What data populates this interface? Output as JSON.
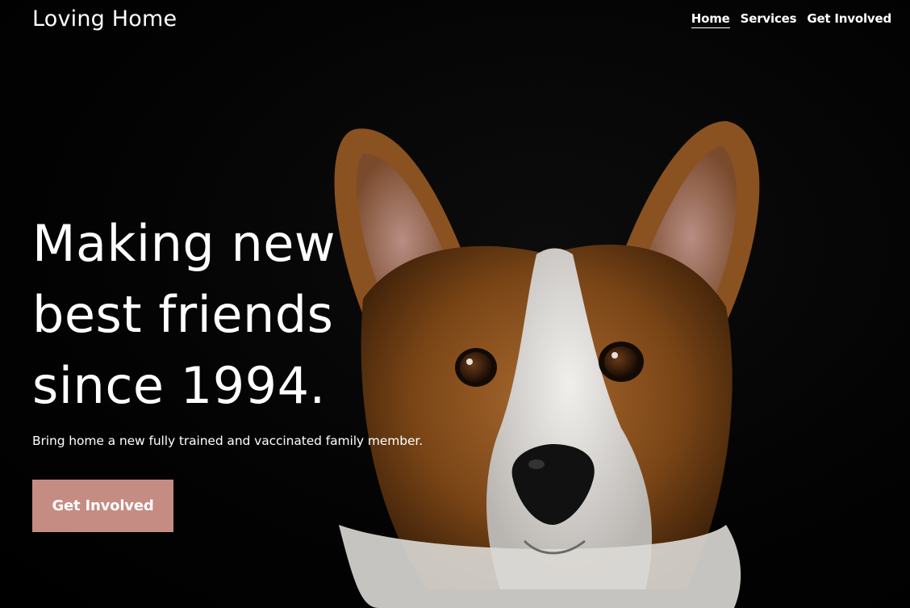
{
  "site": {
    "brand": "Loving Home"
  },
  "nav": {
    "items": [
      {
        "label": "Home",
        "active": true
      },
      {
        "label": "Services",
        "active": false
      },
      {
        "label": "Get Involved",
        "active": false
      }
    ]
  },
  "hero": {
    "headline_lines": [
      "Making new",
      "best friends",
      "since 1994."
    ],
    "subtitle": "Bring home a new fully trained and vaccinated family member.",
    "cta_label": "Get Involved",
    "accent_color": "#c48c82",
    "image_subject": "corgi-dog-photo"
  }
}
